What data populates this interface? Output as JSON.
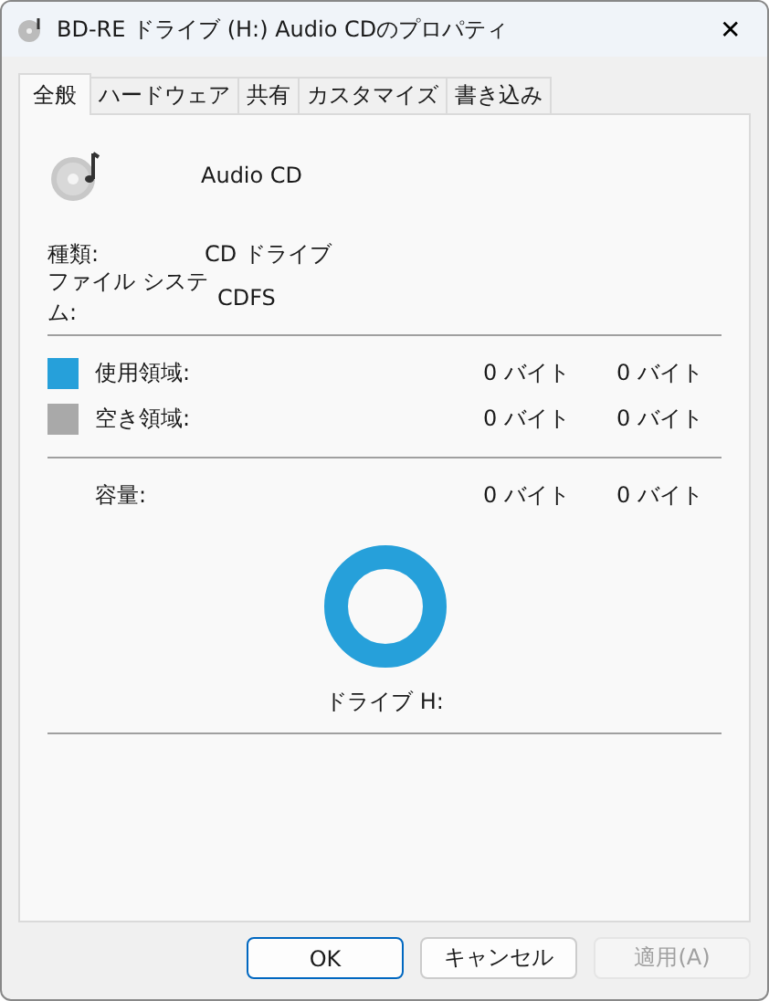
{
  "window": {
    "title": "BD-RE ドライブ (H:) Audio CDのプロパティ",
    "close": "✕"
  },
  "tabs": [
    {
      "label": "全般",
      "selected": true
    },
    {
      "label": "ハードウェア",
      "selected": false
    },
    {
      "label": "共有",
      "selected": false
    },
    {
      "label": "カスタマイズ",
      "selected": false
    },
    {
      "label": "書き込み",
      "selected": false
    }
  ],
  "volume_name": "Audio CD",
  "properties": [
    {
      "label": "種類:",
      "value": "CD ドライブ"
    },
    {
      "label": "ファイル システム:",
      "value": "CDFS"
    }
  ],
  "space": [
    {
      "label": "使用領域:",
      "color": "#26a0da",
      "bytes": "0 バイト",
      "size": "0 バイト"
    },
    {
      "label": "空き領域:",
      "color": "#a9a9a9",
      "bytes": "0 バイト",
      "size": "0 バイト"
    }
  ],
  "capacity": {
    "label": "容量:",
    "bytes": "0 バイト",
    "size": "0 バイト"
  },
  "drive_label": "ドライブ H:",
  "buttons": [
    {
      "label": "OK",
      "default": true,
      "disabled": false
    },
    {
      "label": "キャンセル",
      "default": false,
      "disabled": false
    },
    {
      "label": "適用(A)",
      "default": false,
      "disabled": true
    }
  ]
}
